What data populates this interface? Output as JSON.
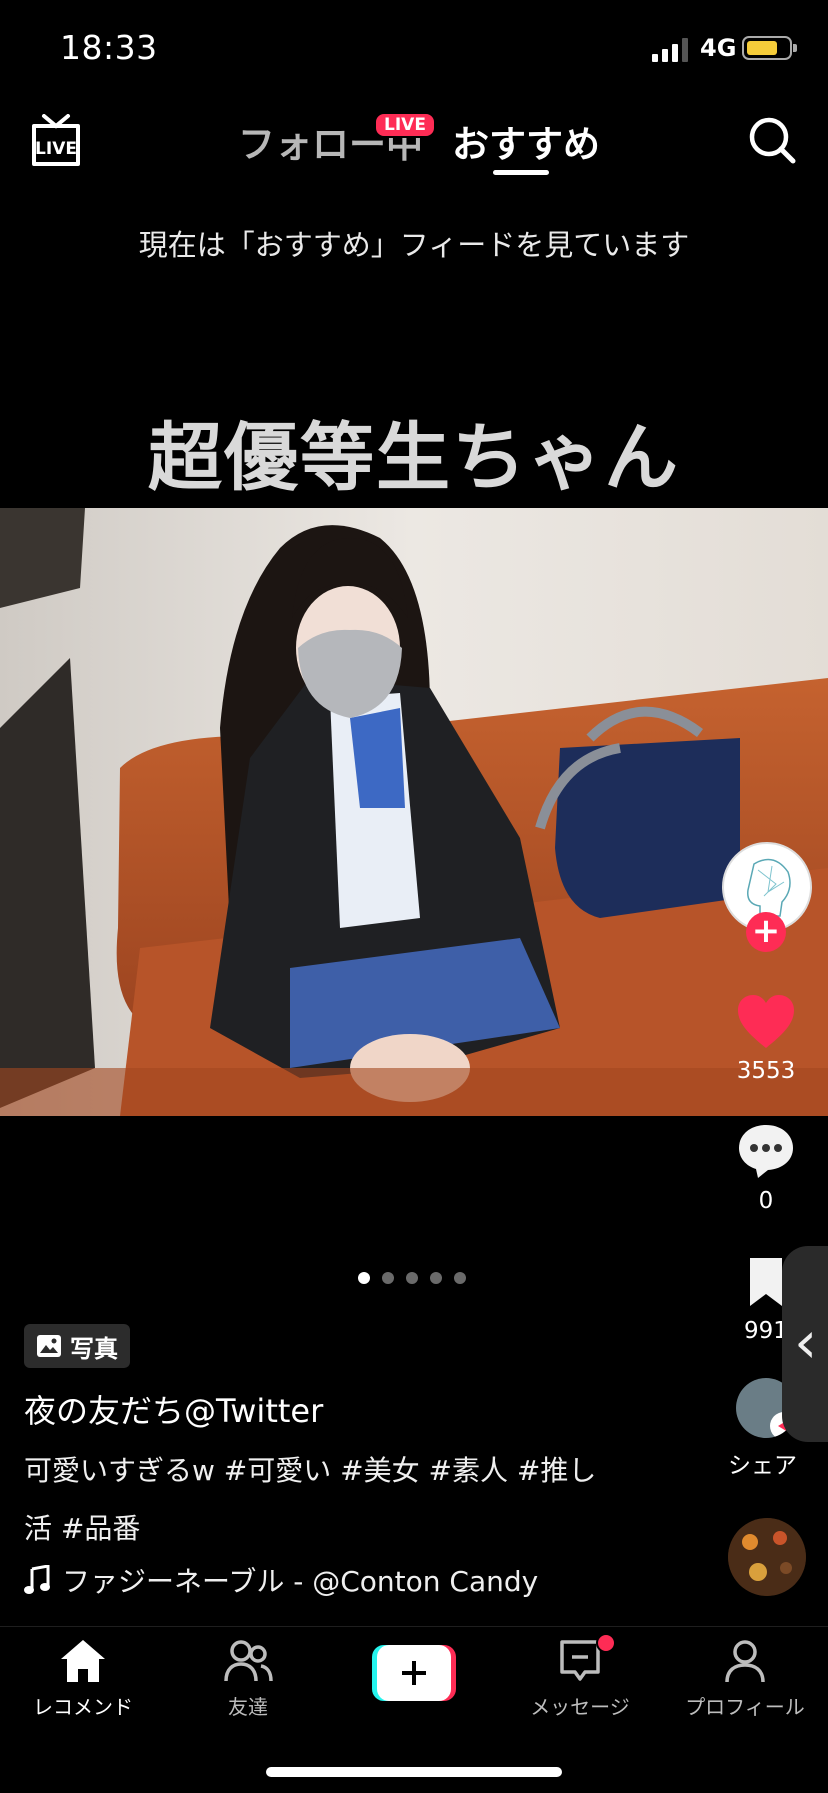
{
  "status_bar": {
    "time": "18:33",
    "network": "4G",
    "battery_color": "#f5cc3a"
  },
  "top_nav": {
    "live_icon": "live-tv-icon",
    "tabs": [
      {
        "label": "フォロー中",
        "badge": "LIVE"
      },
      {
        "label": "おすすめ"
      }
    ],
    "search_icon": "search-icon"
  },
  "feed_notice": "現在は「おすすめ」フィードを見ています",
  "post": {
    "headline": "超優等生ちゃん",
    "pagination": {
      "current": 1,
      "total": 5
    },
    "type_badge": "写真",
    "author": "夜の友だち@Twitter",
    "caption": "可愛いすぎるw #可愛い #美女 #素人 #推し活 #品番",
    "music": "ファジーネーブル - @Conton Candy"
  },
  "actions": {
    "likes": "3553",
    "comments": "0",
    "bookmarks": "991",
    "share_label": "シェア"
  },
  "bottom_nav": [
    {
      "label": "レコメンド",
      "icon": "home-icon"
    },
    {
      "label": "友達",
      "icon": "friends-icon"
    },
    {
      "label": "",
      "icon": "create-plus-icon"
    },
    {
      "label": "メッセージ",
      "icon": "inbox-icon"
    },
    {
      "label": "プロフィール",
      "icon": "profile-icon"
    }
  ],
  "colors": {
    "accent": "#fe2c55",
    "background": "#000000",
    "create_cyan": "#25f4ee"
  }
}
